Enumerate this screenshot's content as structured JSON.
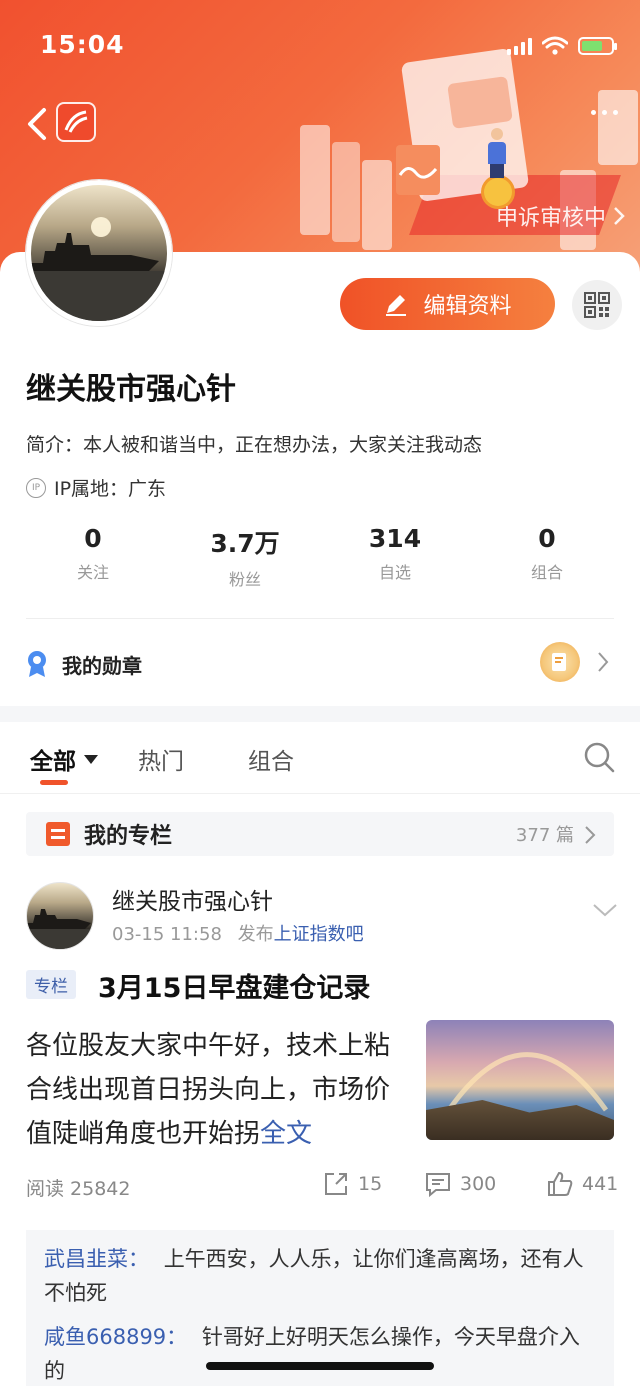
{
  "status_bar": {
    "time": "15:04"
  },
  "header": {
    "appeal_text": "申诉审核中",
    "accent_color": "#f0532b"
  },
  "profile": {
    "edit_label": "编辑资料",
    "name": "继关股市强心针",
    "bio": "简介：本人被和谐当中，正在想办法，大家关注我动态",
    "ip_label": "IP属地：广东",
    "ip_icon_text": "IP"
  },
  "stats": [
    {
      "value": "0",
      "label": "关注"
    },
    {
      "value": "3.7万",
      "label": "粉丝"
    },
    {
      "value": "314",
      "label": "自选"
    },
    {
      "value": "0",
      "label": "组合"
    }
  ],
  "medal": {
    "label": "我的勋章"
  },
  "tabs": [
    {
      "label": "全部"
    },
    {
      "label": "热门"
    },
    {
      "label": "组合"
    }
  ],
  "column": {
    "label": "我的专栏",
    "count": "377 篇"
  },
  "post": {
    "author": "继关股市强心针",
    "time": "03-15 11:58",
    "published_in": "发布",
    "forum": "上证指数吧",
    "tag": "专栏",
    "title": "3月15日早盘建仓记录",
    "excerpt": "各位股友大家中午好，技术上粘合线出现首日拐头向上，市场价值陡峭角度也开始拐",
    "full_text_link": "全文",
    "read_label": "阅读 25842",
    "shares": "15",
    "comments": "300",
    "likes": "441"
  },
  "comments": [
    {
      "user": "武昌韭菜：",
      "text": "上午西安，人人乐，让你们逢高离场，还有人不怕死"
    },
    {
      "user": "咸鱼668899：",
      "text": "针哥好上好明天怎么操作，今天早盘介入的"
    }
  ]
}
